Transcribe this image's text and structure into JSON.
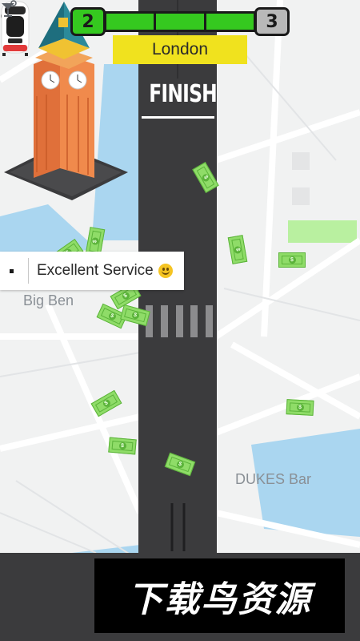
{
  "hud": {
    "level_current": "2",
    "level_next": "3",
    "level_progress": 1.0,
    "city": "London"
  },
  "road": {
    "finish_label": "FINISH"
  },
  "tooltip": {
    "text": "Excellent Service",
    "emoji_icon": "smiley-icon"
  },
  "map_labels": {
    "landmark": "Big Ben",
    "bar": "DUKES Bar"
  },
  "watermark": {
    "text": "下载鸟资源"
  },
  "colors": {
    "progress_fill": "#35c91f",
    "city_label_bg": "#f0e21e",
    "road": "#3b3b3d",
    "water": "#aad6f0",
    "park": "#b9f0a0",
    "cash": "#8fdc68"
  },
  "cash_symbol": "$"
}
